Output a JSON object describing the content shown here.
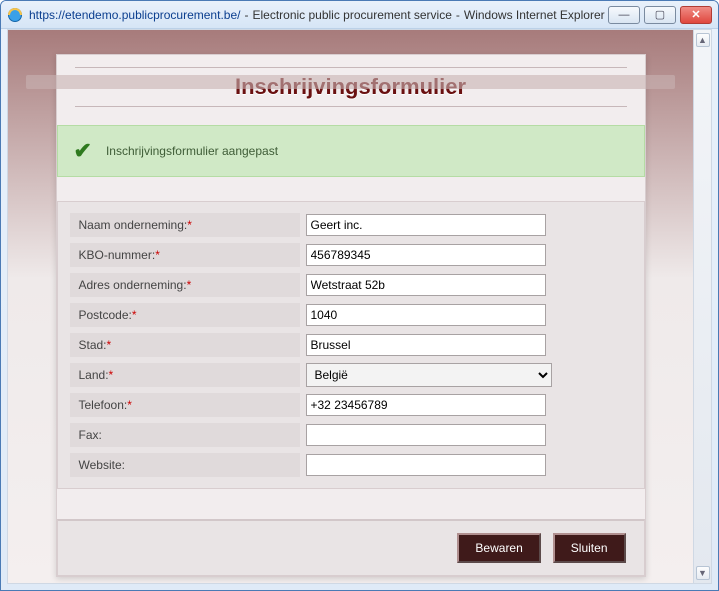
{
  "window": {
    "url": "https://etendemo.publicprocurement.be/",
    "sep": "-",
    "titleA": "Electronic public procurement service",
    "titleB": "Windows Internet Explorer"
  },
  "page": {
    "heading": "Inschrijvingsformulier",
    "alert": "Inschrijvingsformulier aangepast"
  },
  "form": {
    "company_label": "Naam onderneming:",
    "company_value": "Geert inc.",
    "kbo_label": "KBO-nummer:",
    "kbo_value": "456789345",
    "address_label": "Adres onderneming:",
    "address_value": "Wetstraat 52b",
    "postcode_label": "Postcode:",
    "postcode_value": "1040",
    "city_label": "Stad:",
    "city_value": "Brussel",
    "country_label": "Land:",
    "country_value": "België",
    "phone_label": "Telefoon:",
    "phone_value": "+32 23456789",
    "fax_label": "Fax:",
    "fax_value": "",
    "website_label": "Website:",
    "website_value": ""
  },
  "buttons": {
    "save": "Bewaren",
    "close": "Sluiten"
  },
  "required_marker": "*"
}
